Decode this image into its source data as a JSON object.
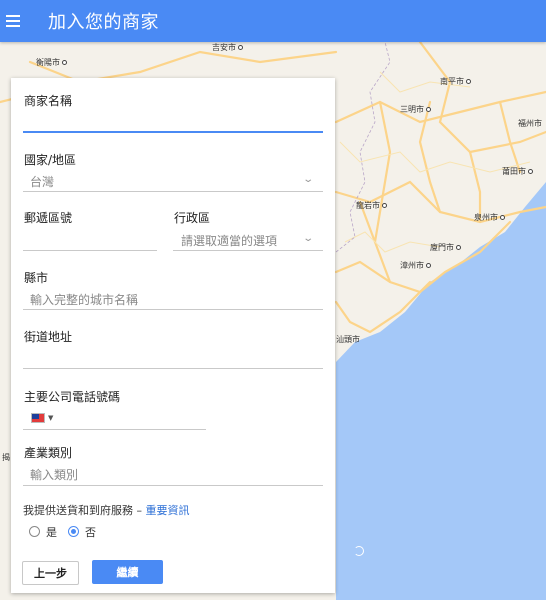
{
  "appbar": {
    "title": "加入您的商家",
    "menu_icon": "hamburger-menu-icon"
  },
  "map": {
    "labels": [
      {
        "text": "衡陽市"
      },
      {
        "text": "吉安市"
      },
      {
        "text": "南平市"
      },
      {
        "text": "三明市"
      },
      {
        "text": "福州市"
      },
      {
        "text": "莆田市"
      },
      {
        "text": "龍岩市"
      },
      {
        "text": "泉州市"
      },
      {
        "text": "廈門市"
      },
      {
        "text": "漳州市"
      },
      {
        "text": "汕頭市"
      },
      {
        "text": "揭"
      }
    ],
    "colors": {
      "land": "#f4f1ea",
      "sea": "#a4c8f8",
      "road": "#fcd48a"
    }
  },
  "form": {
    "business_name": {
      "label": "商家名稱",
      "value": ""
    },
    "country": {
      "label": "國家/地區",
      "value": "台灣"
    },
    "postal_code": {
      "label": "郵遞區號",
      "value": ""
    },
    "district": {
      "label": "行政區",
      "placeholder": "請選取適當的選項"
    },
    "city": {
      "label": "縣市",
      "placeholder": "輸入完整的城市名稱"
    },
    "street": {
      "label": "街道地址",
      "value": ""
    },
    "phone": {
      "label": "主要公司電話號碼",
      "value": ""
    },
    "category": {
      "label": "產業類別",
      "placeholder": "輸入類別"
    },
    "delivery": {
      "question": "我提供送貨和到府服務 – ",
      "link": "重要資訊",
      "options": [
        {
          "label": "是",
          "checked": false
        },
        {
          "label": "否",
          "checked": true
        }
      ]
    },
    "buttons": {
      "back": "上一步",
      "next": "繼續"
    }
  }
}
